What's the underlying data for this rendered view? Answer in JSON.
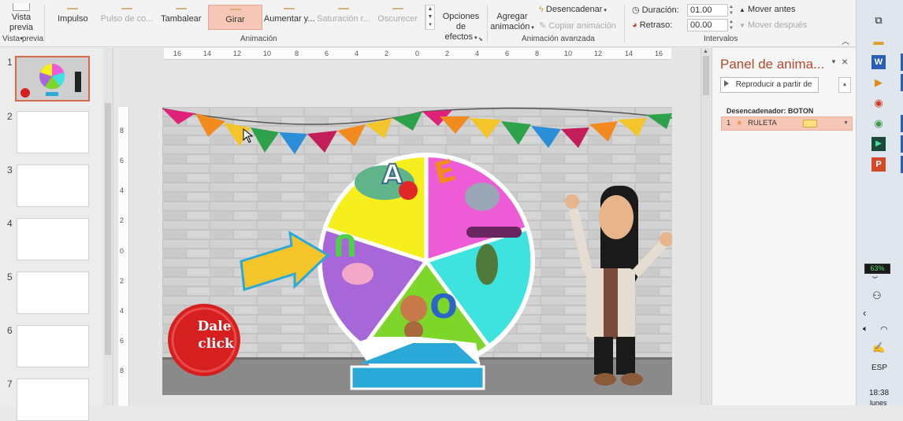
{
  "ribbon": {
    "vista_previa_btn": "Vista previa",
    "vista_previa_group": "Vista previa",
    "effects": [
      {
        "label": "Impulso",
        "state": "normal"
      },
      {
        "label": "Pulso de co...",
        "state": "disabled"
      },
      {
        "label": "Tambalear",
        "state": "normal"
      },
      {
        "label": "Girar",
        "state": "selected"
      },
      {
        "label": "Aumentar y...",
        "state": "normal"
      },
      {
        "label": "Saturación r...",
        "state": "disabled"
      },
      {
        "label": "Oscurecer",
        "state": "disabled"
      }
    ],
    "animation_group": "Animación",
    "effect_options_line1": "Opciones de",
    "effect_options_line2": "efectos",
    "add_animation_line1": "Agregar",
    "add_animation_line2": "animación",
    "trigger": "Desencadenar",
    "copy_animation": "Copiar animación",
    "advanced_group": "Animación avanzada",
    "duration_label": "Duración:",
    "duration_value": "01.00",
    "delay_label": "Retraso:",
    "delay_value": "00.00",
    "move_earlier": "Mover antes",
    "move_later": "Mover después",
    "timing_group": "Intervalos"
  },
  "slides_panel": {
    "numbers": [
      "1",
      "2",
      "3",
      "4",
      "5",
      "6",
      "7"
    ]
  },
  "ruler": {
    "h_ticks": [
      "16",
      "14",
      "12",
      "10",
      "8",
      "6",
      "4",
      "2",
      "0",
      "2",
      "4",
      "6",
      "8",
      "10",
      "12",
      "14",
      "16"
    ],
    "v_ticks": [
      "8",
      "6",
      "4",
      "2",
      "0",
      "2",
      "4",
      "6",
      "8"
    ]
  },
  "slide": {
    "wheel_letters": [
      "A",
      "E",
      "U",
      "O"
    ],
    "button_line1": "Dale",
    "button_line2": "click",
    "colors": {
      "yellow": "#f7ee1e",
      "magenta": "#ee5bd6",
      "cyan": "#3ee3e0",
      "green": "#7fd62a",
      "purple": "#a867d8",
      "base": "#2aa8d8",
      "button": "#d62020"
    }
  },
  "animation_pane": {
    "title": "Panel de anima...",
    "play_from": "Reproducir a partir de",
    "trigger_label": "Desencadenador: BOTON",
    "item_number": "1",
    "item_name": "RULETA"
  },
  "taskbar": {
    "battery": "63%",
    "language": "ESP",
    "time": "18:38",
    "day": "lunes",
    "icons": [
      "task-view-icon",
      "file-explorer-icon",
      "word-icon",
      "video-player-icon",
      "chrome-icon",
      "chrome-alt-icon",
      "media-icon",
      "powerpoint-icon"
    ]
  }
}
